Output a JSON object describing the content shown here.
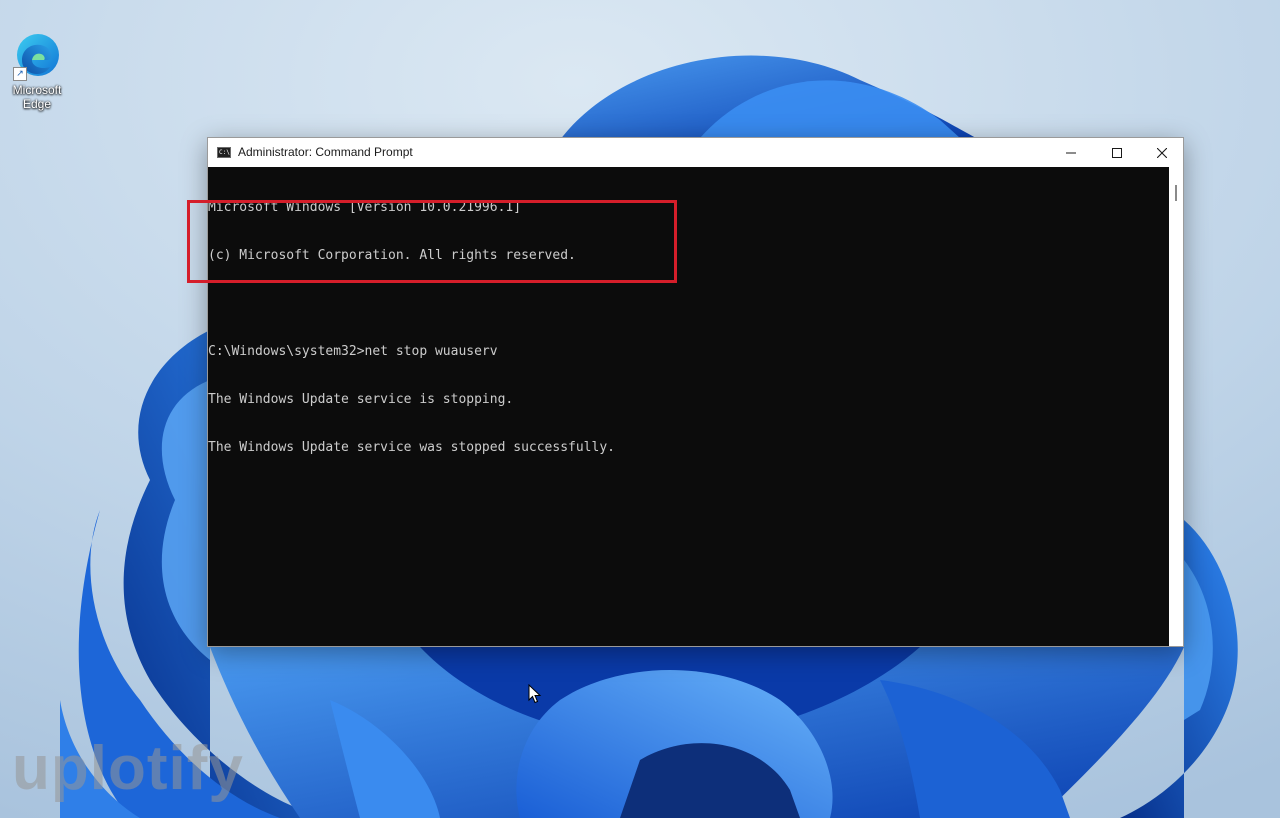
{
  "desktop": {
    "icons": [
      {
        "label_line1": "Microsoft",
        "label_line2": "Edge",
        "icon": "edge-icon"
      }
    ],
    "shortcut_glyph": "↗"
  },
  "window": {
    "title": "Administrator: Command Prompt",
    "app_icon": "cmd-icon",
    "app_icon_text": "C:\\",
    "controls": {
      "minimize": "minimize-icon",
      "maximize": "maximize-icon",
      "close": "close-icon"
    }
  },
  "console": {
    "lines": [
      "Microsoft Windows [Version 10.0.21996.1]",
      "(c) Microsoft Corporation. All rights reserved.",
      "",
      "C:\\Windows\\system32>net stop wuauserv",
      "The Windows Update service is stopping.",
      "The Windows Update service was stopped successfully."
    ],
    "text_color": "#cccccc",
    "background": "#0c0c0c"
  },
  "annotation": {
    "highlight_color": "#d51e2a"
  },
  "watermark": {
    "text": "uplotify"
  }
}
